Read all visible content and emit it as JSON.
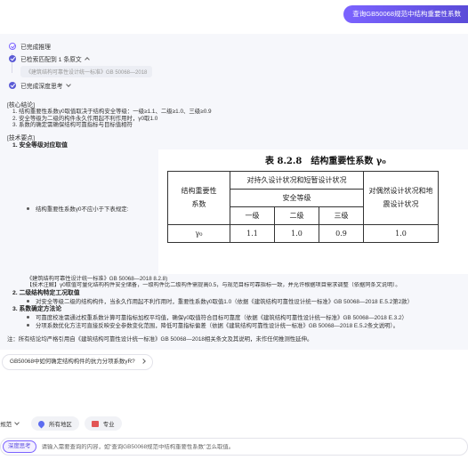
{
  "header": {
    "query_pill": "查询GB50068规范中结构重要性系数"
  },
  "steps": {
    "step1": "已完成推理",
    "step2": "已检索匹配到 1 条原文",
    "source_chip": "《建筑结构可靠性设计统一标准》GB 50068—2018",
    "step3": "已完成深度思考"
  },
  "core": {
    "title": "[核心结论]",
    "items": [
      "1. 结构重要性系数γ0取值取决于结构安全等级：一级≥1.1、二级≥1.0、三级≥0.9",
      "2. 安全等级为二级的构件永久作用起不利作用时，γ0取1.0",
      "3. 系数的确定需确保结构可靠指标与目标值相符"
    ]
  },
  "tech": {
    "title": "[技术要点]",
    "h1": "1. 安全等级对应取值",
    "bullet1": "结构重要性系数γ0不应小于下表规定:",
    "source1": "《建筑结构可靠性设计统一标准》GB 50068—2018 8.2.8)",
    "note1": "【技术注解】γ0取值可量化结构构件安全储备，一级构件比二级构件需提高0.5，与规范目标可靠指标一致，并允许根据项目需求调整（依据同条文说明）。",
    "h2": "2. 二级结构特定工况取值",
    "bullet2": "对安全等级二级的结构构件，当永久作用起不利作用时，重要性系数γ0取值1.0（依据《建筑结构可靠性设计统一标准》GB 50068—2018 E.5.2第2款）",
    "h3": "3. 系数确定方法论",
    "bullet3": "可靠度校准需通过权重系数计算可靠指标加权平均值，确保γ0取值符合目标可靠度（依据《建筑结构可靠性设计统一标准》GB 50068—2018 E.3.2）",
    "bullet4": "分项系数优化方法可直接反映安全参数变化范围，降低可靠指标偏差（依据《建筑结构可靠性设计统一标准》GB 50068—2018 E.5.2条文说明）。"
  },
  "table": {
    "title": "表 8.2.8　结构重要性系数 γ₀",
    "col_main": "结构重要性系数",
    "col_persist": "对持久设计状况和短暂设计状况",
    "col_safety": "安全等级",
    "col_accident": "对偶然设计状况和地震设计状况",
    "levels": [
      "一级",
      "二级",
      "三级"
    ],
    "row_label": "γ₀",
    "values": [
      "1.1",
      "1.0",
      "0.9",
      "1.0"
    ]
  },
  "footnote": "注：所有结论均严格引用自《建筑结构可靠性设计统一标准》GB 50068—2018相关条文及其说明，未作任何推测性延伸。",
  "suggestion": "GB50068中如何确定结构构件的抗力分项系数γR?",
  "filters": {
    "scope": "查规范",
    "region": "所有地区",
    "type": "专业"
  },
  "input": {
    "mode": "深度思考",
    "placeholder": "请输入需要查询的内容，如“查询GB50068规范中结构重要性系数”怎么取值。"
  }
}
